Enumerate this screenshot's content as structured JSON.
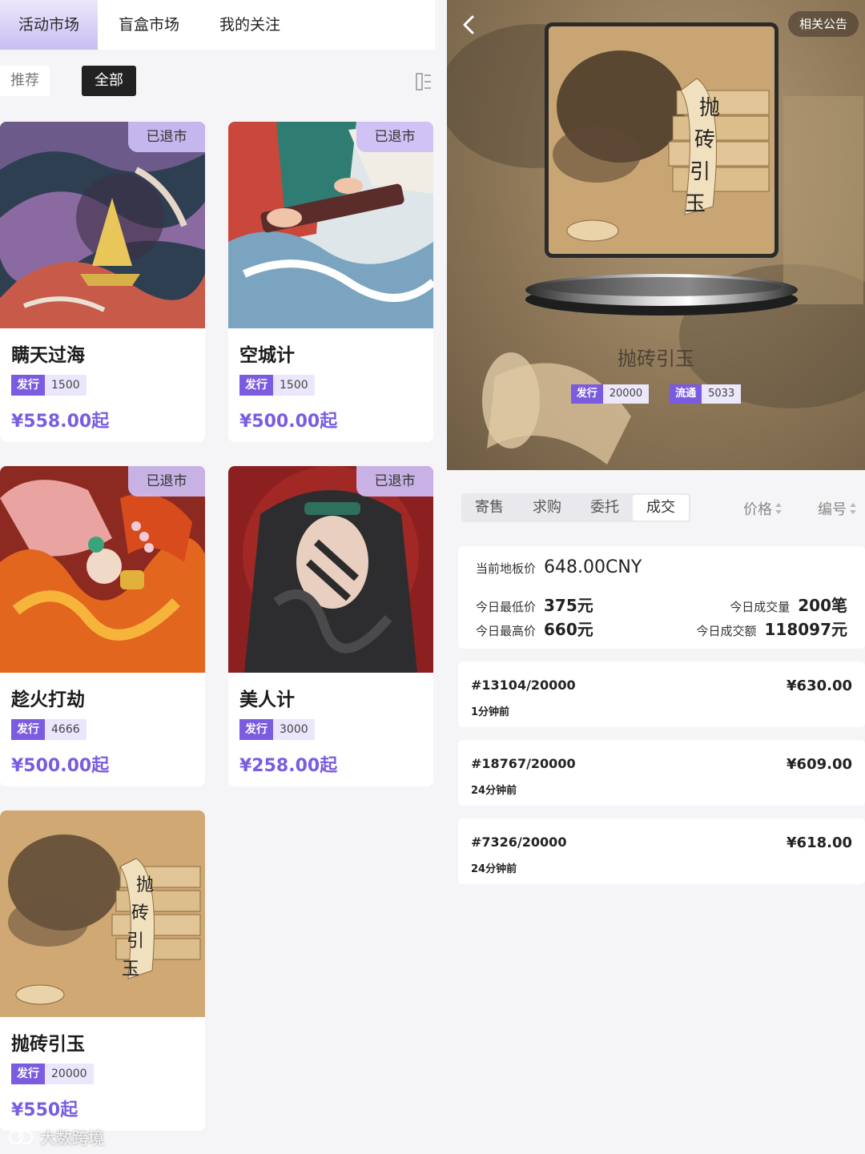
{
  "left": {
    "tabs": [
      {
        "label": "活动市场"
      },
      {
        "label": "盲盒市场"
      },
      {
        "label": "我的关注"
      }
    ],
    "filters": [
      {
        "label": "推荐"
      },
      {
        "label": "全部"
      }
    ],
    "cards": [
      {
        "badge": "已退市",
        "name": "瞒天过海",
        "tag_key": "发行",
        "tag_value": "1500",
        "price": "¥558.00起"
      },
      {
        "badge": "已退市",
        "name": "空城计",
        "tag_key": "发行",
        "tag_value": "1500",
        "price": "¥500.00起"
      },
      {
        "badge": "已退市",
        "name": "趁火打劫",
        "tag_key": "发行",
        "tag_value": "4666",
        "price": "¥500.00起"
      },
      {
        "badge": "已退市",
        "name": "美人计",
        "tag_key": "发行",
        "tag_value": "3000",
        "price": "¥258.00起"
      },
      {
        "name": "抛砖引玉",
        "tag_key": "发行",
        "tag_value": "20000",
        "price": "¥550起"
      }
    ],
    "watermark": "大数跨境"
  },
  "right": {
    "notice": "相关公告",
    "title": "抛砖引玉",
    "tags": [
      {
        "key": "发行",
        "value": "20000"
      },
      {
        "key": "流通",
        "value": "5033"
      }
    ],
    "segments": [
      {
        "label": "寄售"
      },
      {
        "label": "求购"
      },
      {
        "label": "委托"
      },
      {
        "label": "成交"
      }
    ],
    "sorts": [
      {
        "label": "价格"
      },
      {
        "label": "编号"
      }
    ],
    "stats": {
      "floor_label": "当前地板价",
      "floor_value": "648.00CNY",
      "low_label": "今日最低价",
      "low_value": "375元",
      "high_label": "今日最高价",
      "high_value": "660元",
      "volume_label": "今日成交量",
      "volume_value": "200笔",
      "amount_label": "今日成交额",
      "amount_value": "118097元"
    },
    "trades": [
      {
        "no": "#13104/20000",
        "time": "1分钟前",
        "amount": "¥630.00"
      },
      {
        "no": "#18767/20000",
        "time": "24分钟前",
        "amount": "¥609.00"
      },
      {
        "no": "#7326/20000",
        "time": "24分钟前",
        "amount": "¥618.00"
      }
    ]
  }
}
